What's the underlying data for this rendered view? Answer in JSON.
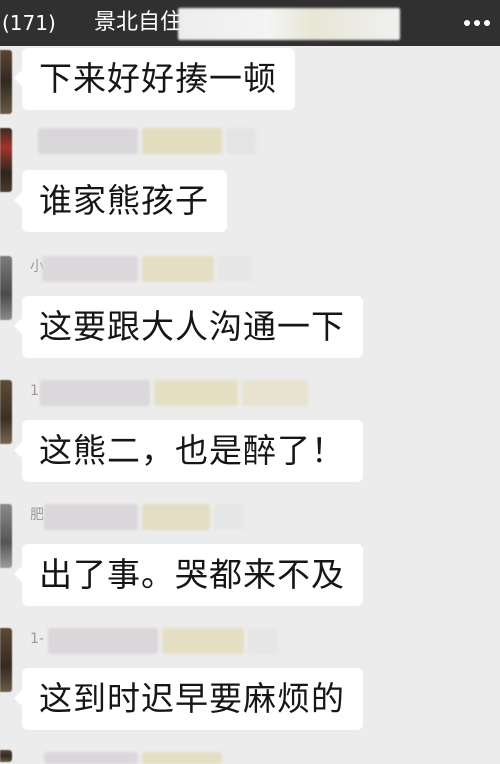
{
  "header": {
    "unread_count": "(171)",
    "chat_title": "景北自住"
  },
  "messages": [
    {
      "sender_initial": "",
      "text": "下来好好揍一顿"
    },
    {
      "sender_initial": "",
      "text": "谁家熊孩子"
    },
    {
      "sender_initial": "小",
      "text": "这要跟大人沟通一下"
    },
    {
      "sender_initial": "1",
      "text": "这熊二，也是醉了！"
    },
    {
      "sender_initial": "肥",
      "text": "出了事。哭都来不及"
    },
    {
      "sender_initial": "1-",
      "text": "这到时迟早要麻烦的"
    }
  ],
  "colors": {
    "topbar": "#303030",
    "background": "#ececec",
    "bubble": "#ffffff"
  },
  "icons": {
    "more": "more-dots-icon"
  }
}
